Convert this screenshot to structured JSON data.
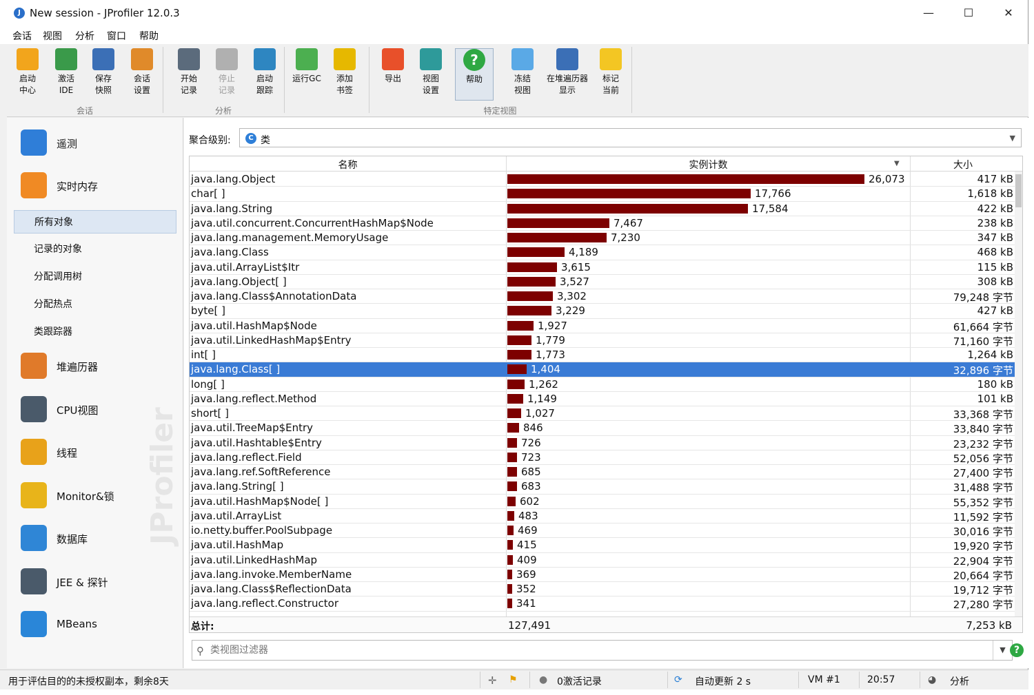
{
  "window": {
    "title": "New session - JProfiler 12.0.3",
    "minimize": "—",
    "maximize": "☐",
    "close": "✕"
  },
  "menu": [
    "会话",
    "视图",
    "分析",
    "窗口",
    "帮助"
  ],
  "toolbar": {
    "groups": [
      {
        "label": "会话"
      },
      {
        "label": "分析"
      },
      {
        "label": "特定视图"
      }
    ],
    "buttons": [
      {
        "id": "start-center",
        "line1": "启动",
        "line2": "中心",
        "icon": "folder-play-icon",
        "color": "#f2a51c"
      },
      {
        "id": "activate-ide",
        "line1": "激活",
        "line2": "IDE",
        "icon": "ide-arrow-icon",
        "color": "#3a9a4a"
      },
      {
        "id": "save-snapshot",
        "line1": "保存",
        "line2": "快照",
        "icon": "floppy-disk-icon",
        "color": "#3b6fb6"
      },
      {
        "id": "session-settings",
        "line1": "会话",
        "line2": "设置",
        "icon": "clipboard-edit-icon",
        "color": "#e08a2a"
      },
      {
        "id": "start-recording",
        "line1": "开始",
        "line2": "记录",
        "icon": "film-reel-play-icon",
        "color": "#5b6b7c"
      },
      {
        "id": "stop-recording",
        "line1": "停止",
        "line2": "记录",
        "icon": "film-reel-stop-icon",
        "color": "#b0b0b0",
        "disabled": true
      },
      {
        "id": "start-tracking",
        "line1": "启动",
        "line2": "跟踪",
        "icon": "tracker-icon",
        "color": "#2e86c1"
      },
      {
        "id": "run-gc",
        "line1": "运行GC",
        "line2": "",
        "icon": "recycle-icon",
        "color": "#4caf50"
      },
      {
        "id": "add-bookmark",
        "line1": "添加",
        "line2": "书签",
        "icon": "bookmark-add-icon",
        "color": "#e6b800"
      },
      {
        "id": "export",
        "line1": "导出",
        "line2": "",
        "icon": "export-arrow-icon",
        "color": "#e8502a"
      },
      {
        "id": "view-settings",
        "line1": "视图",
        "line2": "设置",
        "icon": "view-settings-icon",
        "color": "#2e9a9a"
      },
      {
        "id": "help",
        "line1": "帮助",
        "line2": "",
        "icon": "help-circle-icon",
        "color": "#2ea843",
        "pressed": true
      },
      {
        "id": "freeze-view",
        "line1": "冻结",
        "line2": "视图",
        "icon": "snowflake-icon",
        "color": "#5aa9e6"
      },
      {
        "id": "show-in-heap-walker",
        "line1": "在堆遍历器",
        "line2": "显示",
        "icon": "camera-icon",
        "color": "#3b6fb6"
      },
      {
        "id": "mark-current",
        "line1": "标记",
        "line2": "当前",
        "icon": "sticky-note-icon",
        "color": "#f3c623"
      }
    ]
  },
  "sidebar": {
    "watermark": "JProfiler",
    "items": [
      {
        "type": "main",
        "label": "遥测",
        "icon": "telemetry-icon",
        "color": "#2f7ed8"
      },
      {
        "type": "main",
        "label": "实时内存",
        "icon": "live-memory-icon",
        "color": "#f08a24"
      },
      {
        "type": "sub",
        "label": "所有对象",
        "selected": true
      },
      {
        "type": "sub",
        "label": "记录的对象"
      },
      {
        "type": "sub",
        "label": "分配调用树"
      },
      {
        "type": "sub",
        "label": "分配热点"
      },
      {
        "type": "sub",
        "label": "类跟踪器"
      },
      {
        "type": "main",
        "label": "堆遍历器",
        "icon": "heap-walker-icon",
        "color": "#e07a2a"
      },
      {
        "type": "main",
        "label": "CPU视图",
        "icon": "cpu-icon",
        "color": "#4a5a6a"
      },
      {
        "type": "main",
        "label": "线程",
        "icon": "threads-icon",
        "color": "#e8a21a"
      },
      {
        "type": "main",
        "label": "Monitor&锁",
        "icon": "lock-icon",
        "color": "#e8b41a"
      },
      {
        "type": "main",
        "label": "数据库",
        "icon": "database-icon",
        "color": "#2f86d6"
      },
      {
        "type": "main",
        "label": "JEE & 探针",
        "icon": "gauge-icon",
        "color": "#4a5a6a"
      },
      {
        "type": "main",
        "label": "MBeans",
        "icon": "globe-icon",
        "color": "#2a86d8"
      }
    ]
  },
  "aggregation": {
    "label": "聚合级别:",
    "icon_letter": "C",
    "value": "类"
  },
  "table": {
    "columns": {
      "name": "名称",
      "count": "实例计数",
      "size": "大小",
      "sort": "▼"
    },
    "max_count": 26073,
    "rows": [
      {
        "name": "java.lang.Object",
        "count": "26,073",
        "n": 26073,
        "size": "417 kB"
      },
      {
        "name": "char[ ]",
        "count": "17,766",
        "n": 17766,
        "size": "1,618 kB"
      },
      {
        "name": "java.lang.String",
        "count": "17,584",
        "n": 17584,
        "size": "422 kB"
      },
      {
        "name": "java.util.concurrent.ConcurrentHashMap$Node",
        "count": "7,467",
        "n": 7467,
        "size": "238 kB"
      },
      {
        "name": "java.lang.management.MemoryUsage",
        "count": "7,230",
        "n": 7230,
        "size": "347 kB"
      },
      {
        "name": "java.lang.Class",
        "count": "4,189",
        "n": 4189,
        "size": "468 kB"
      },
      {
        "name": "java.util.ArrayList$Itr",
        "count": "3,615",
        "n": 3615,
        "size": "115 kB"
      },
      {
        "name": "java.lang.Object[ ]",
        "count": "3,527",
        "n": 3527,
        "size": "308 kB"
      },
      {
        "name": "java.lang.Class$AnnotationData",
        "count": "3,302",
        "n": 3302,
        "size": "79,248 字节"
      },
      {
        "name": "byte[ ]",
        "count": "3,229",
        "n": 3229,
        "size": "427 kB"
      },
      {
        "name": "java.util.HashMap$Node",
        "count": "1,927",
        "n": 1927,
        "size": "61,664 字节"
      },
      {
        "name": "java.util.LinkedHashMap$Entry",
        "count": "1,779",
        "n": 1779,
        "size": "71,160 字节"
      },
      {
        "name": "int[ ]",
        "count": "1,773",
        "n": 1773,
        "size": "1,264 kB"
      },
      {
        "name": "java.lang.Class[ ]",
        "count": "1,404",
        "n": 1404,
        "size": "32,896 字节",
        "selected": true
      },
      {
        "name": "long[ ]",
        "count": "1,262",
        "n": 1262,
        "size": "180 kB"
      },
      {
        "name": "java.lang.reflect.Method",
        "count": "1,149",
        "n": 1149,
        "size": "101 kB"
      },
      {
        "name": "short[ ]",
        "count": "1,027",
        "n": 1027,
        "size": "33,368 字节"
      },
      {
        "name": "java.util.TreeMap$Entry",
        "count": "846",
        "n": 846,
        "size": "33,840 字节"
      },
      {
        "name": "java.util.Hashtable$Entry",
        "count": "726",
        "n": 726,
        "size": "23,232 字节"
      },
      {
        "name": "java.lang.reflect.Field",
        "count": "723",
        "n": 723,
        "size": "52,056 字节"
      },
      {
        "name": "java.lang.ref.SoftReference",
        "count": "685",
        "n": 685,
        "size": "27,400 字节"
      },
      {
        "name": "java.lang.String[ ]",
        "count": "683",
        "n": 683,
        "size": "31,488 字节"
      },
      {
        "name": "java.util.HashMap$Node[ ]",
        "count": "602",
        "n": 602,
        "size": "55,352 字节"
      },
      {
        "name": "java.util.ArrayList",
        "count": "483",
        "n": 483,
        "size": "11,592 字节"
      },
      {
        "name": "io.netty.buffer.PoolSubpage",
        "count": "469",
        "n": 469,
        "size": "30,016 字节"
      },
      {
        "name": "java.util.HashMap",
        "count": "415",
        "n": 415,
        "size": "19,920 字节"
      },
      {
        "name": "java.util.LinkedHashMap",
        "count": "409",
        "n": 409,
        "size": "22,904 字节"
      },
      {
        "name": "java.lang.invoke.MemberName",
        "count": "369",
        "n": 369,
        "size": "20,664 字节"
      },
      {
        "name": "java.lang.Class$ReflectionData",
        "count": "352",
        "n": 352,
        "size": "19,712 字节"
      },
      {
        "name": "java.lang.reflect.Constructor",
        "count": "341",
        "n": 341,
        "size": "27,280 字节"
      }
    ],
    "total": {
      "label": "总计:",
      "count": "127,491",
      "size": "7,253 kB"
    }
  },
  "filter": {
    "placeholder": "类视图过滤器"
  },
  "status": {
    "license": "用于评估目的的未授权副本，剩余8天",
    "recordings": "0激活记录",
    "auto_update": "自动更新 2 s",
    "vm": "VM #1",
    "time": "20:57",
    "mode": "分析"
  }
}
